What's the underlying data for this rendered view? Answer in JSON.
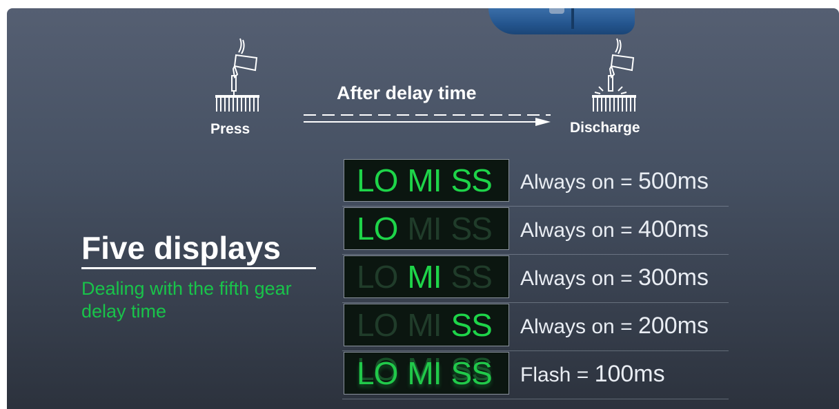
{
  "diagram": {
    "press_label": "Press",
    "discharge_label": "Discharge",
    "delay_label": "After delay time"
  },
  "heading": {
    "title": "Five displays",
    "subtitle": "Dealing with the fifth gear delay time"
  },
  "rows": [
    {
      "segments": [
        "LO",
        "MI",
        "SS"
      ],
      "lit": [
        true,
        true,
        true
      ],
      "mode": "Always on =",
      "value": "500ms"
    },
    {
      "segments": [
        "LO",
        "MI",
        "SS"
      ],
      "lit": [
        true,
        false,
        false
      ],
      "mode": "Always on =",
      "value": "400ms"
    },
    {
      "segments": [
        "LO",
        "MI",
        "SS"
      ],
      "lit": [
        false,
        true,
        false
      ],
      "mode": "Always on =",
      "value": "300ms"
    },
    {
      "segments": [
        "LO",
        "MI",
        "SS"
      ],
      "lit": [
        false,
        false,
        true
      ],
      "mode": "Always on =",
      "value": "200ms"
    },
    {
      "segments": [
        "LO",
        "MI",
        "SS"
      ],
      "lit": [
        true,
        true,
        true
      ],
      "mode": "Flash =",
      "value": "100ms"
    }
  ],
  "colors": {
    "accent_green": "#19c34a",
    "lcd_green": "#1ed449",
    "background": "#465163"
  }
}
